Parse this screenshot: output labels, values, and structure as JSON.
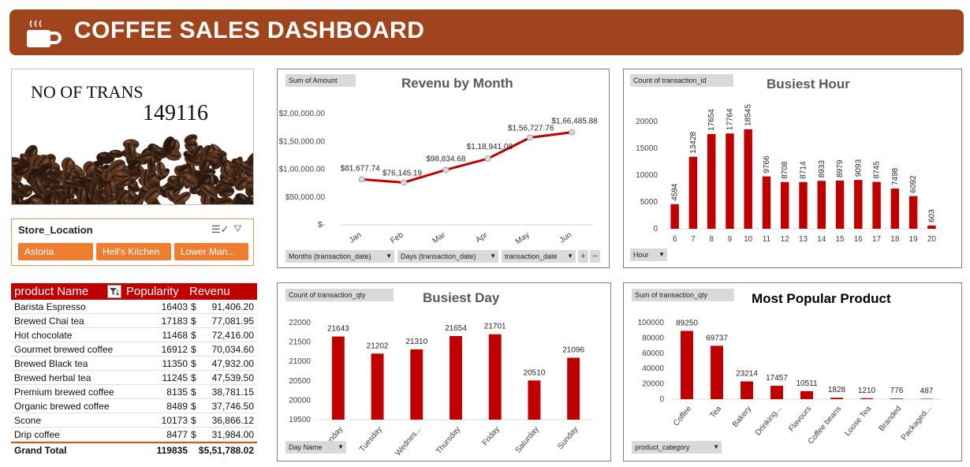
{
  "header": {
    "title": "COFFEE SALES DASHBOARD",
    "icon": "coffee-cup-icon",
    "bg_color": "#a0441e"
  },
  "kpi": {
    "label": "NO OF TRANS",
    "value": "149116"
  },
  "slicer": {
    "title": "Store_Location",
    "items": [
      "Astoria",
      "Hell's Kitchen",
      "Lower Man..."
    ],
    "accent": "#ed7d31",
    "icons": [
      "multi-select-icon",
      "clear-filter-icon"
    ]
  },
  "product_table": {
    "headers": {
      "name": "product Name",
      "popularity": "Popularity",
      "revenue": "Revenu"
    },
    "currency": "$",
    "rows": [
      {
        "name": "Barista Espresso",
        "pop": "16403",
        "rev": "91,406.20"
      },
      {
        "name": "Brewed Chai tea",
        "pop": "17183",
        "rev": "77,081.95"
      },
      {
        "name": "Hot chocolate",
        "pop": "11468",
        "rev": "72,416.00"
      },
      {
        "name": "Gourmet brewed coffee",
        "pop": "16912",
        "rev": "70,034.60"
      },
      {
        "name": "Brewed Black tea",
        "pop": "11350",
        "rev": "47,932.00"
      },
      {
        "name": "Brewed herbal tea",
        "pop": "11245",
        "rev": "47,539.50"
      },
      {
        "name": "Premium brewed coffee",
        "pop": "8135",
        "rev": "38,781.15"
      },
      {
        "name": "Organic brewed coffee",
        "pop": "8489",
        "rev": "37,746.50"
      },
      {
        "name": "Scone",
        "pop": "10173",
        "rev": "36,866.12"
      },
      {
        "name": "Drip coffee",
        "pop": "8477",
        "rev": "31,984.00"
      }
    ],
    "total": {
      "name": "Grand Total",
      "pop": "119835",
      "rev": "$5,51,788.02"
    }
  },
  "revenue_chart": {
    "tag": "Sum of Amount",
    "title": "Revenu by Month",
    "filters": [
      "Months (transaction_date)",
      "Days (transaction_date)",
      "transaction_date"
    ],
    "plus": "+",
    "minus": "−"
  },
  "hour_chart": {
    "tag": "Count of transaction_id",
    "title": "Busiest Hour",
    "filter": "Hour"
  },
  "day_chart": {
    "tag": "Count of transaction_qty",
    "title": "Busiest Day",
    "filter": "Day Name"
  },
  "product_chart": {
    "tag": "Sum of transaction_qty",
    "title": "Most Popular Product",
    "filter": "product_category"
  },
  "chart_data": [
    {
      "type": "line",
      "title": "Revenu by Month",
      "categories": [
        "Jan",
        "Feb",
        "Mar",
        "Apr",
        "May",
        "Jun"
      ],
      "values": [
        81677.74,
        76145.19,
        98834.68,
        118941.08,
        156727.76,
        166485.88
      ],
      "labels": [
        "$81,677.74",
        "$76,145.19",
        "$98,834.68",
        "$1,18,941.08",
        "$1,56,727.76",
        "$1,66,485.88"
      ],
      "yticks": [
        "$-",
        "$50,000.00",
        "$1,00,000.00",
        "$1,50,000.00",
        "$2,00,000.00"
      ],
      "ylim": [
        0,
        200000
      ],
      "color": "#c00000"
    },
    {
      "type": "bar",
      "title": "Busiest Hour",
      "categories": [
        "6",
        "7",
        "8",
        "9",
        "10",
        "11",
        "12",
        "13",
        "14",
        "15",
        "16",
        "17",
        "18",
        "19",
        "20"
      ],
      "values": [
        4594,
        13428,
        17654,
        17764,
        18545,
        9766,
        8708,
        8714,
        8933,
        8979,
        9093,
        8745,
        7498,
        6092,
        603
      ],
      "yticks": [
        "0",
        "5000",
        "10000",
        "15000",
        "20000"
      ],
      "ylim": [
        0,
        20000
      ],
      "color": "#c00000"
    },
    {
      "type": "bar",
      "title": "Busiest Day",
      "categories": [
        "Monday",
        "Tuesday",
        "Wednes...",
        "Thursday",
        "Friday",
        "Saturday",
        "Sunday"
      ],
      "values": [
        21643,
        21202,
        21310,
        21654,
        21701,
        20510,
        21096
      ],
      "yticks": [
        "19500",
        "20000",
        "20500",
        "21000",
        "21500",
        "22000"
      ],
      "ylim": [
        19500,
        22000
      ],
      "color": "#c00000"
    },
    {
      "type": "bar",
      "title": "Most Popular Product",
      "categories": [
        "Coffee",
        "Tea",
        "Bakery",
        "Drinking...",
        "Flavours",
        "Coffee beans",
        "Loose Tea",
        "Branded",
        "Packaged..."
      ],
      "values": [
        89250,
        69737,
        23214,
        17457,
        10511,
        1828,
        1210,
        776,
        487
      ],
      "yticks": [
        "0",
        "20000",
        "40000",
        "60000",
        "80000",
        "100000"
      ],
      "ylim": [
        0,
        100000
      ],
      "color": "#c00000"
    }
  ]
}
